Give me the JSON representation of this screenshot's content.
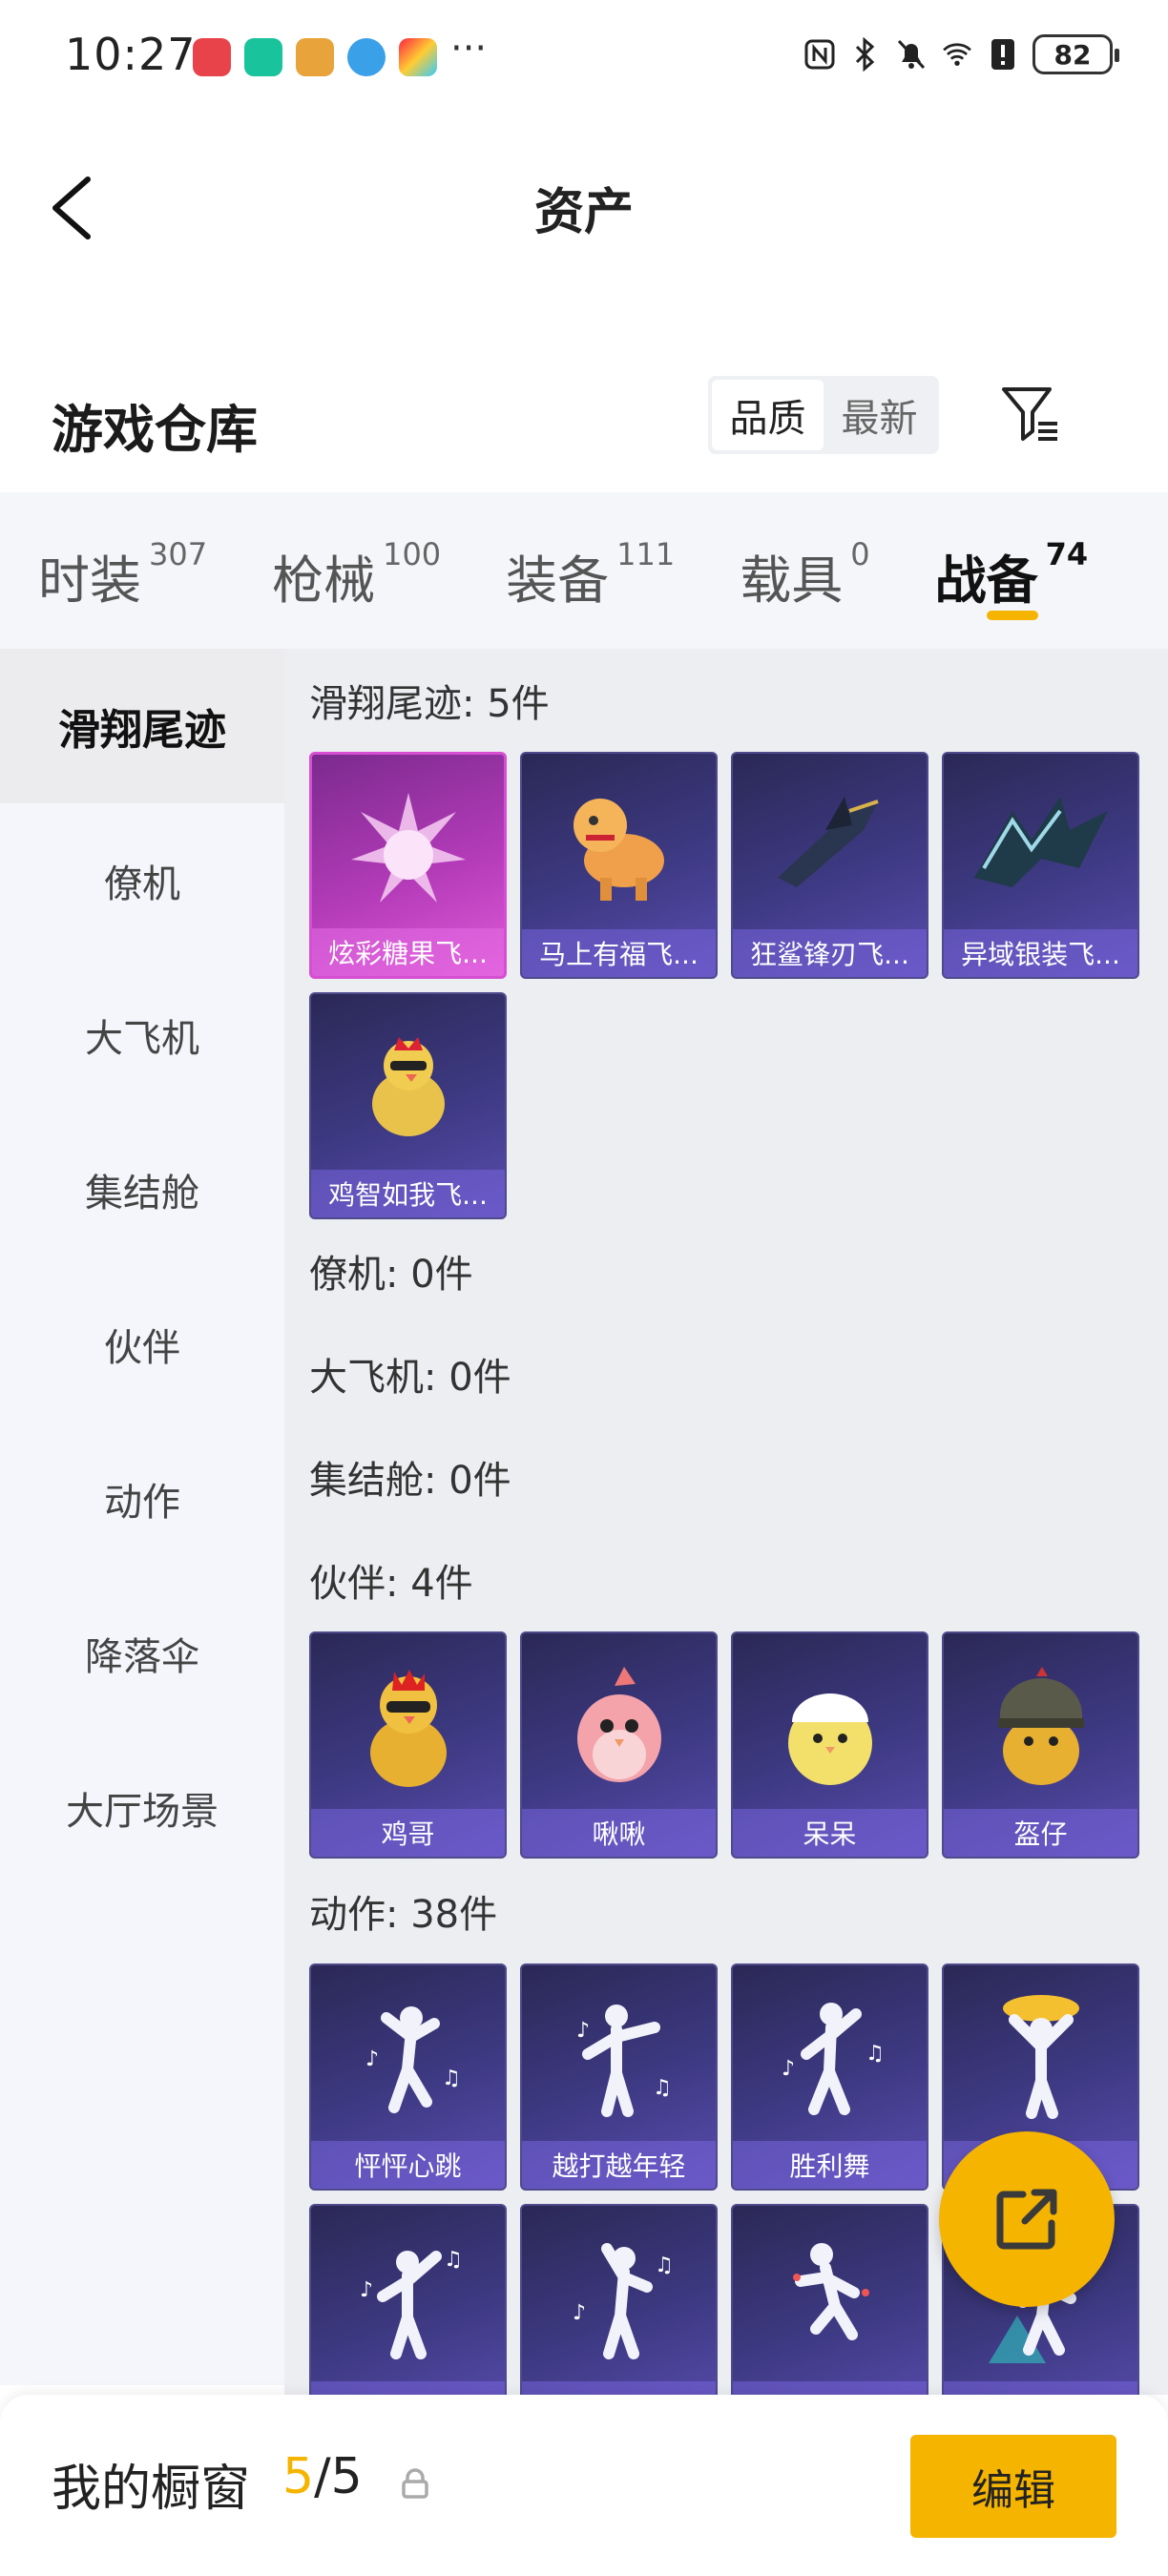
{
  "status_bar": {
    "time": "10:27",
    "more": "···",
    "battery": "82"
  },
  "header": {
    "title": "资产"
  },
  "warehouse": {
    "title": "游戏仓库",
    "sort_options": [
      "品质",
      "最新"
    ],
    "active_sort": "品质"
  },
  "tabs": [
    {
      "label": "时装",
      "count": "307"
    },
    {
      "label": "枪械",
      "count": "100"
    },
    {
      "label": "装备",
      "count": "111"
    },
    {
      "label": "载具",
      "count": "0"
    },
    {
      "label": "战备",
      "count": "74"
    }
  ],
  "active_tab": "战备",
  "sidebar": {
    "items": [
      "滑翔尾迹",
      "僚机",
      "大飞机",
      "集结舱",
      "伙伴",
      "动作",
      "降落伞",
      "大厅场景"
    ],
    "active": "滑翔尾迹"
  },
  "sections": {
    "glide": {
      "header": "滑翔尾迹: 5件",
      "items": [
        "炫彩糖果飞...",
        "马上有福飞...",
        "狂鲨锋刃飞...",
        "异域银装飞...",
        "鸡智如我飞..."
      ]
    },
    "wingman": {
      "header": "僚机: 0件"
    },
    "plane": {
      "header": "大飞机: 0件"
    },
    "pod": {
      "header": "集结舱: 0件"
    },
    "partner": {
      "header": "伙伴: 4件",
      "items": [
        "鸡哥",
        "啾啾",
        "呆呆",
        "盔仔"
      ]
    },
    "emote": {
      "header": "动作: 38件",
      "items": [
        "怦怦心跳",
        "越打越年轻",
        "胜利舞",
        "",
        "",
        "",
        "",
        ""
      ]
    }
  },
  "bottom": {
    "label": "我的橱窗",
    "current": "5",
    "separator": "/",
    "total": "5",
    "edit_label": "编辑"
  },
  "colors": {
    "accent": "#f5b400",
    "card_purple": "#3e3a84",
    "card_pink": "#b33bb8"
  }
}
